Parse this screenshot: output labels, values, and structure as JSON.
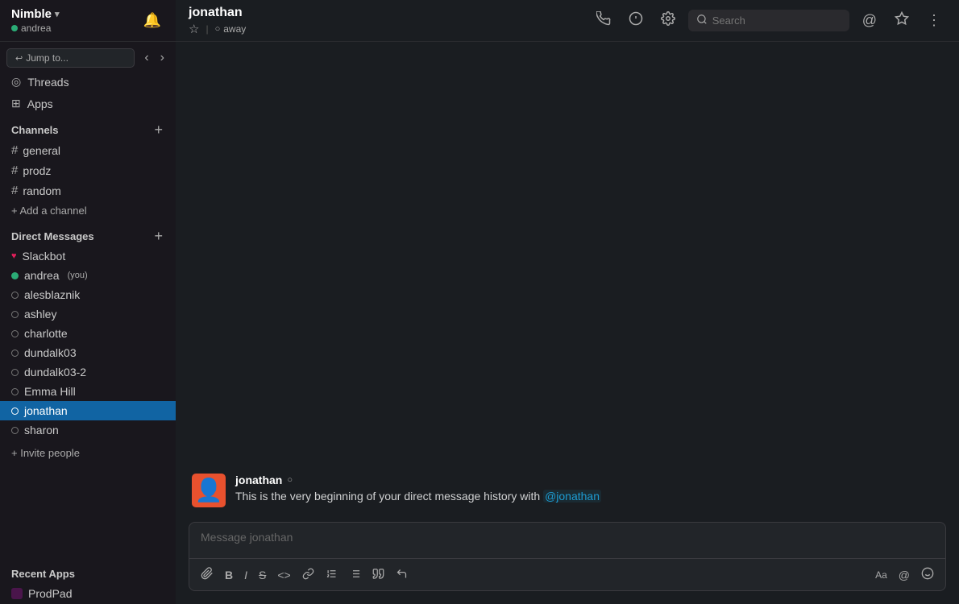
{
  "workspace": {
    "name": "Nimble",
    "user": "andrea",
    "status_dot": "green"
  },
  "sidebar": {
    "jump_to_label": "Jump to...",
    "threads_label": "Threads",
    "apps_label": "Apps",
    "channels_section_label": "Channels",
    "channels": [
      {
        "name": "general"
      },
      {
        "name": "prodz"
      },
      {
        "name": "random"
      }
    ],
    "add_channel_label": "+ Add a channel",
    "dm_section_label": "Direct Messages",
    "dms": [
      {
        "name": "Slackbot",
        "status": "heart"
      },
      {
        "name": "andrea",
        "you": true,
        "status": "green"
      },
      {
        "name": "alesblaznik",
        "status": "hollow"
      },
      {
        "name": "ashley",
        "status": "hollow"
      },
      {
        "name": "charlotte",
        "status": "hollow"
      },
      {
        "name": "dundalk03",
        "status": "hollow"
      },
      {
        "name": "dundalk03-2",
        "status": "hollow"
      },
      {
        "name": "Emma Hill",
        "status": "hollow"
      },
      {
        "name": "jonathan",
        "status": "hollow",
        "active": true
      },
      {
        "name": "sharon",
        "status": "hollow"
      }
    ],
    "invite_people_label": "+ Invite people",
    "recent_apps_label": "Recent Apps",
    "recent_apps": [
      {
        "name": "ProdPad"
      }
    ]
  },
  "header": {
    "user_name": "jonathan",
    "status_label": "away",
    "star_label": "★",
    "search_placeholder": "Search"
  },
  "chat": {
    "sender_name": "jonathan",
    "sender_status": "○",
    "history_text": "This is the very beginning of your direct message history with",
    "mention": "@jonathan"
  },
  "composer": {
    "placeholder": "Message jonathan",
    "toolbar": {
      "attach": "📎",
      "bold": "B",
      "italic": "I",
      "strikethrough": "S",
      "code": "<>",
      "link": "🔗",
      "ordered_list": "≡",
      "unordered_list": "≡",
      "blockquote": "❝",
      "more": "↩",
      "text_format": "Aa",
      "mention": "@",
      "emoji": "☺"
    }
  },
  "icons": {
    "bell": "🔔",
    "chevron": "▾",
    "back_arrow": "‹",
    "forward_arrow": "›",
    "info": "ℹ",
    "settings": "⚙",
    "at": "@",
    "star": "☆",
    "more": "⋮",
    "phone": "📞",
    "plus": "+"
  }
}
